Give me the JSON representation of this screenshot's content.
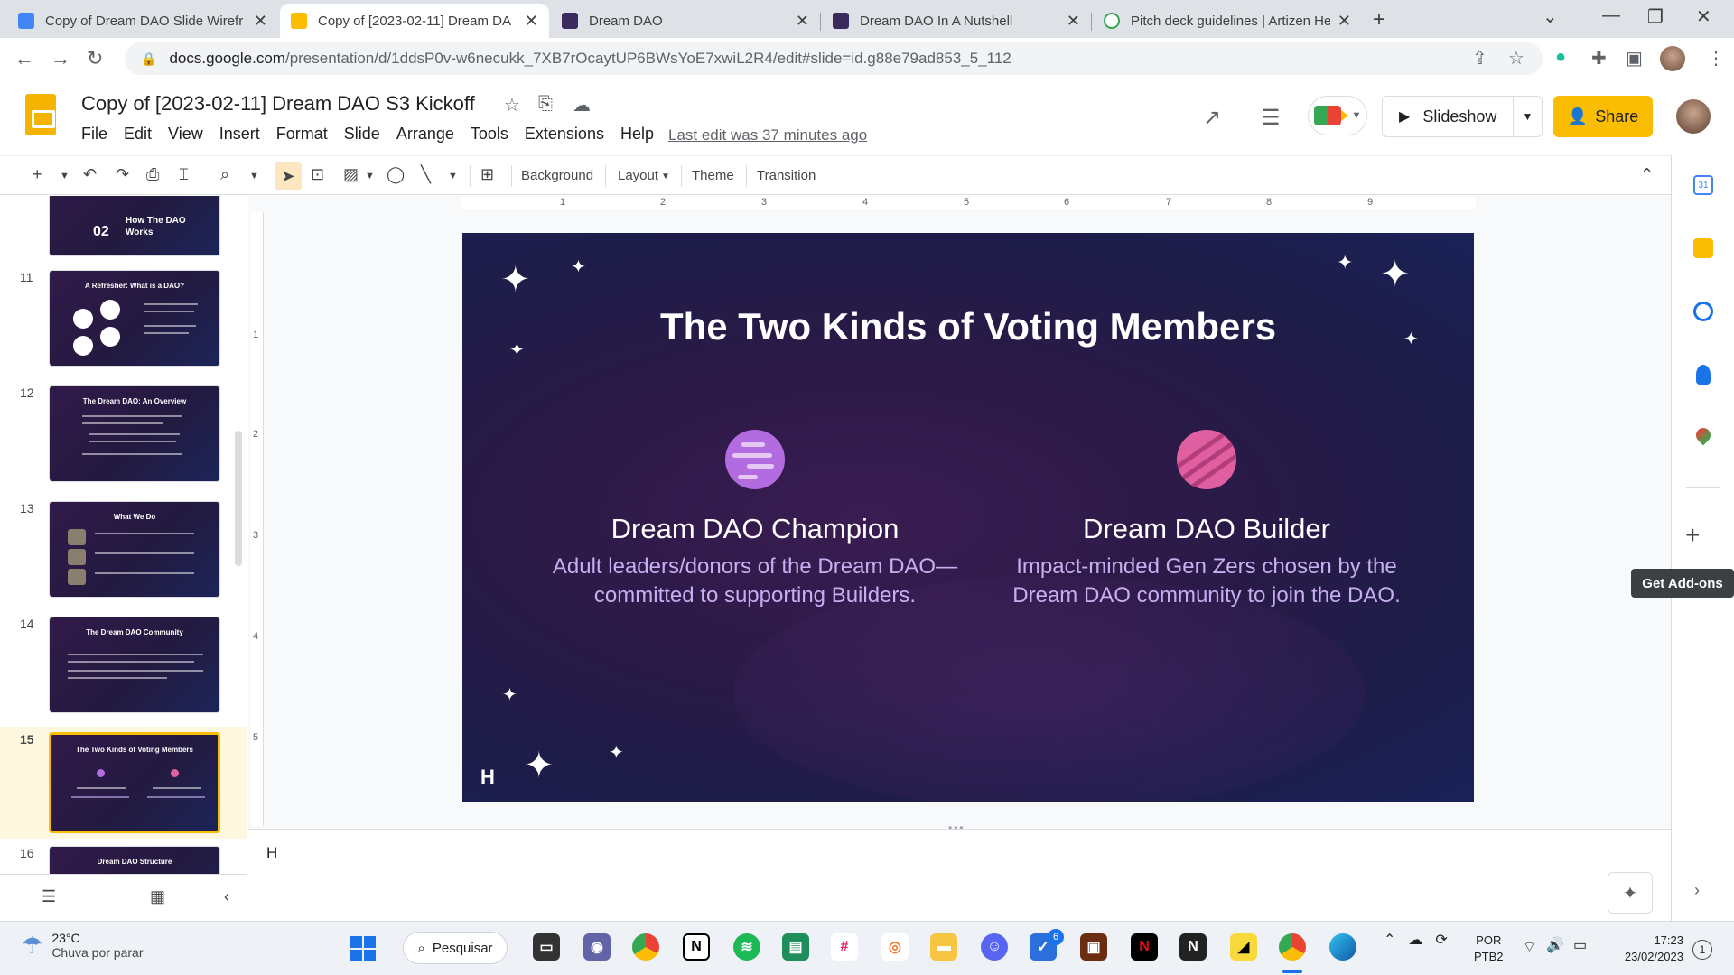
{
  "browser": {
    "tabs": [
      {
        "title": "Copy of Dream DAO Slide Wirefr",
        "active": false
      },
      {
        "title": "Copy of [2023-02-11] Dream DA",
        "active": true
      },
      {
        "title": "Dream DAO",
        "active": false
      },
      {
        "title": "Dream DAO In A Nutshell",
        "active": false
      },
      {
        "title": "Pitch deck guidelines | Artizen He",
        "active": false
      }
    ],
    "url_host": "docs.google.com",
    "url_path": "/presentation/d/1ddsP0v-w6necukk_7XB7rOcaytUP6BWsYoE7xwiL2R4/edit#slide=id.g88e79ad853_5_112"
  },
  "docs": {
    "title": "Copy of [2023-02-11] Dream DAO S3 Kickoff",
    "menu": [
      "File",
      "Edit",
      "View",
      "Insert",
      "Format",
      "Slide",
      "Arrange",
      "Tools",
      "Extensions",
      "Help"
    ],
    "last_edit": "Last edit was 37 minutes ago",
    "slideshow_label": "Slideshow",
    "share_label": "Share"
  },
  "toolbar": {
    "background": "Background",
    "layout": "Layout",
    "theme": "Theme",
    "transition": "Transition"
  },
  "ruler": {
    "top": [
      "1",
      "2",
      "3",
      "4",
      "5",
      "6",
      "7",
      "8",
      "9"
    ],
    "left": [
      "1",
      "2",
      "3",
      "4",
      "5"
    ]
  },
  "filmstrip": [
    {
      "number": "",
      "title": "How The DAO Works",
      "badge": "02"
    },
    {
      "number": "11",
      "title": "A Refresher: What is a DAO?"
    },
    {
      "number": "12",
      "title": "The Dream DAO: An Overview"
    },
    {
      "number": "13",
      "title": "What We Do"
    },
    {
      "number": "14",
      "title": "The Dream DAO Community"
    },
    {
      "number": "15",
      "title": "The Two Kinds of Voting Members",
      "selected": true
    },
    {
      "number": "16",
      "title": "Dream DAO Structure"
    }
  ],
  "slide": {
    "title": "The Two Kinds of Voting Members",
    "champion": {
      "heading": "Dream DAO Champion",
      "body": "Adult leaders/donors of the Dream DAO—committed to supporting Builders."
    },
    "builder": {
      "heading": "Dream DAO Builder",
      "body": "Impact-minded Gen Zers chosen by the Dream DAO community to join the DAO."
    },
    "logo_letter": "H"
  },
  "notes_text": "H",
  "sidepanel": {
    "addon_tooltip": "Get Add-ons",
    "calendar_day": "31"
  },
  "taskbar": {
    "temperature": "23°C",
    "weather": "Chuva por parar",
    "search_label": "Pesquisar",
    "steam_badge": "6",
    "lang_top": "POR",
    "lang_bottom": "PTB2",
    "time": "17:23",
    "date": "23/02/2023",
    "notification_count": "1"
  },
  "colors": {
    "accent_yellow": "#fbbc04",
    "slide_text_accent": "#c7aef0",
    "planet_purple": "#b36be0",
    "planet_pink": "#e05fa0"
  }
}
